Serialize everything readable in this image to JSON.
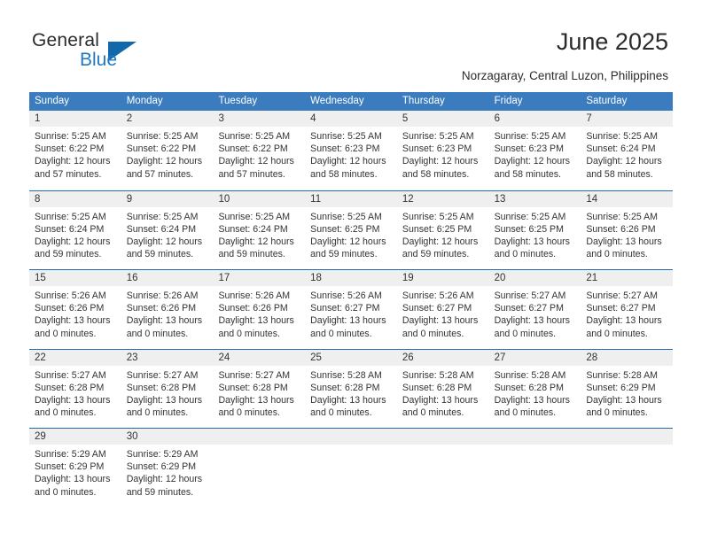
{
  "brand": {
    "name_part1": "General",
    "name_part2": "Blue",
    "color_primary": "#1169ab",
    "color_text": "#2b2b2b"
  },
  "header": {
    "title": "June 2025",
    "subtitle": "Norzagaray, Central Luzon, Philippines"
  },
  "calendar": {
    "header_bg": "#3b7cbf",
    "row_divider": "#1f6cb0",
    "daynum_bg": "#efefef",
    "weekdays": [
      "Sunday",
      "Monday",
      "Tuesday",
      "Wednesday",
      "Thursday",
      "Friday",
      "Saturday"
    ],
    "weeks": [
      [
        {
          "day": "1",
          "lines": [
            "Sunrise: 5:25 AM",
            "Sunset: 6:22 PM",
            "Daylight: 12 hours",
            "and 57 minutes."
          ]
        },
        {
          "day": "2",
          "lines": [
            "Sunrise: 5:25 AM",
            "Sunset: 6:22 PM",
            "Daylight: 12 hours",
            "and 57 minutes."
          ]
        },
        {
          "day": "3",
          "lines": [
            "Sunrise: 5:25 AM",
            "Sunset: 6:22 PM",
            "Daylight: 12 hours",
            "and 57 minutes."
          ]
        },
        {
          "day": "4",
          "lines": [
            "Sunrise: 5:25 AM",
            "Sunset: 6:23 PM",
            "Daylight: 12 hours",
            "and 58 minutes."
          ]
        },
        {
          "day": "5",
          "lines": [
            "Sunrise: 5:25 AM",
            "Sunset: 6:23 PM",
            "Daylight: 12 hours",
            "and 58 minutes."
          ]
        },
        {
          "day": "6",
          "lines": [
            "Sunrise: 5:25 AM",
            "Sunset: 6:23 PM",
            "Daylight: 12 hours",
            "and 58 minutes."
          ]
        },
        {
          "day": "7",
          "lines": [
            "Sunrise: 5:25 AM",
            "Sunset: 6:24 PM",
            "Daylight: 12 hours",
            "and 58 minutes."
          ]
        }
      ],
      [
        {
          "day": "8",
          "lines": [
            "Sunrise: 5:25 AM",
            "Sunset: 6:24 PM",
            "Daylight: 12 hours",
            "and 59 minutes."
          ]
        },
        {
          "day": "9",
          "lines": [
            "Sunrise: 5:25 AM",
            "Sunset: 6:24 PM",
            "Daylight: 12 hours",
            "and 59 minutes."
          ]
        },
        {
          "day": "10",
          "lines": [
            "Sunrise: 5:25 AM",
            "Sunset: 6:24 PM",
            "Daylight: 12 hours",
            "and 59 minutes."
          ]
        },
        {
          "day": "11",
          "lines": [
            "Sunrise: 5:25 AM",
            "Sunset: 6:25 PM",
            "Daylight: 12 hours",
            "and 59 minutes."
          ]
        },
        {
          "day": "12",
          "lines": [
            "Sunrise: 5:25 AM",
            "Sunset: 6:25 PM",
            "Daylight: 12 hours",
            "and 59 minutes."
          ]
        },
        {
          "day": "13",
          "lines": [
            "Sunrise: 5:25 AM",
            "Sunset: 6:25 PM",
            "Daylight: 13 hours",
            "and 0 minutes."
          ]
        },
        {
          "day": "14",
          "lines": [
            "Sunrise: 5:25 AM",
            "Sunset: 6:26 PM",
            "Daylight: 13 hours",
            "and 0 minutes."
          ]
        }
      ],
      [
        {
          "day": "15",
          "lines": [
            "Sunrise: 5:26 AM",
            "Sunset: 6:26 PM",
            "Daylight: 13 hours",
            "and 0 minutes."
          ]
        },
        {
          "day": "16",
          "lines": [
            "Sunrise: 5:26 AM",
            "Sunset: 6:26 PM",
            "Daylight: 13 hours",
            "and 0 minutes."
          ]
        },
        {
          "day": "17",
          "lines": [
            "Sunrise: 5:26 AM",
            "Sunset: 6:26 PM",
            "Daylight: 13 hours",
            "and 0 minutes."
          ]
        },
        {
          "day": "18",
          "lines": [
            "Sunrise: 5:26 AM",
            "Sunset: 6:27 PM",
            "Daylight: 13 hours",
            "and 0 minutes."
          ]
        },
        {
          "day": "19",
          "lines": [
            "Sunrise: 5:26 AM",
            "Sunset: 6:27 PM",
            "Daylight: 13 hours",
            "and 0 minutes."
          ]
        },
        {
          "day": "20",
          "lines": [
            "Sunrise: 5:27 AM",
            "Sunset: 6:27 PM",
            "Daylight: 13 hours",
            "and 0 minutes."
          ]
        },
        {
          "day": "21",
          "lines": [
            "Sunrise: 5:27 AM",
            "Sunset: 6:27 PM",
            "Daylight: 13 hours",
            "and 0 minutes."
          ]
        }
      ],
      [
        {
          "day": "22",
          "lines": [
            "Sunrise: 5:27 AM",
            "Sunset: 6:28 PM",
            "Daylight: 13 hours",
            "and 0 minutes."
          ]
        },
        {
          "day": "23",
          "lines": [
            "Sunrise: 5:27 AM",
            "Sunset: 6:28 PM",
            "Daylight: 13 hours",
            "and 0 minutes."
          ]
        },
        {
          "day": "24",
          "lines": [
            "Sunrise: 5:27 AM",
            "Sunset: 6:28 PM",
            "Daylight: 13 hours",
            "and 0 minutes."
          ]
        },
        {
          "day": "25",
          "lines": [
            "Sunrise: 5:28 AM",
            "Sunset: 6:28 PM",
            "Daylight: 13 hours",
            "and 0 minutes."
          ]
        },
        {
          "day": "26",
          "lines": [
            "Sunrise: 5:28 AM",
            "Sunset: 6:28 PM",
            "Daylight: 13 hours",
            "and 0 minutes."
          ]
        },
        {
          "day": "27",
          "lines": [
            "Sunrise: 5:28 AM",
            "Sunset: 6:28 PM",
            "Daylight: 13 hours",
            "and 0 minutes."
          ]
        },
        {
          "day": "28",
          "lines": [
            "Sunrise: 5:28 AM",
            "Sunset: 6:29 PM",
            "Daylight: 13 hours",
            "and 0 minutes."
          ]
        }
      ],
      [
        {
          "day": "29",
          "lines": [
            "Sunrise: 5:29 AM",
            "Sunset: 6:29 PM",
            "Daylight: 13 hours",
            "and 0 minutes."
          ]
        },
        {
          "day": "30",
          "lines": [
            "Sunrise: 5:29 AM",
            "Sunset: 6:29 PM",
            "Daylight: 12 hours",
            "and 59 minutes."
          ]
        },
        {
          "day": "",
          "lines": []
        },
        {
          "day": "",
          "lines": []
        },
        {
          "day": "",
          "lines": []
        },
        {
          "day": "",
          "lines": []
        },
        {
          "day": "",
          "lines": []
        }
      ]
    ]
  }
}
